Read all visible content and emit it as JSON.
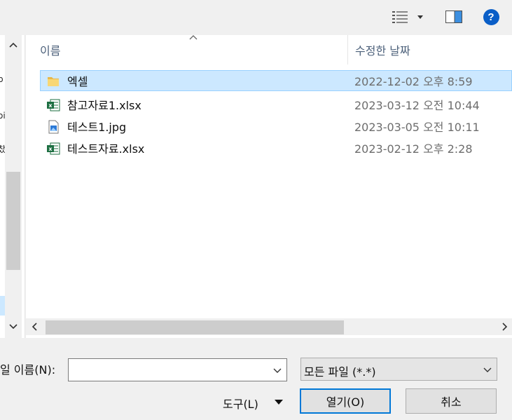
{
  "toolbar": {
    "view_icon": "list-view-icon",
    "preview_icon": "preview-pane-icon",
    "help_label": "?"
  },
  "nav": {
    "items": [
      {
        "label": "p"
      },
      {
        "label": "oi"
      },
      {
        "label": "찼"
      }
    ]
  },
  "file_list": {
    "columns": [
      "이름",
      "수정한 날짜"
    ],
    "rows": [
      {
        "name": "엑셀",
        "date": "2022-12-02 오후 8:59",
        "icon": "folder-icon",
        "selected": true
      },
      {
        "name": "참고자료1.xlsx",
        "date": "2023-03-12 오전 10:44",
        "icon": "excel-file-icon",
        "selected": false
      },
      {
        "name": "테스트1.jpg",
        "date": "2023-03-05 오전 10:11",
        "icon": "image-file-icon",
        "selected": false
      },
      {
        "name": "테스트자료.xlsx",
        "date": "2023-02-12 오후 2:28",
        "icon": "excel-file-icon",
        "selected": false
      }
    ]
  },
  "bottom": {
    "filename_label": "일 이름(N):",
    "filename_value": "",
    "filetype_value": "모든 파일 (*.*)",
    "tools_label": "도구(L)",
    "open_label": "열기(O)",
    "cancel_label": "취소"
  },
  "colors": {
    "selection": "#cce8ff",
    "selection_border": "#99d1ff",
    "accent": "#0078d7",
    "help": "#0a5ec7",
    "excel": "#1d6f42",
    "folder": "#f8d775"
  }
}
